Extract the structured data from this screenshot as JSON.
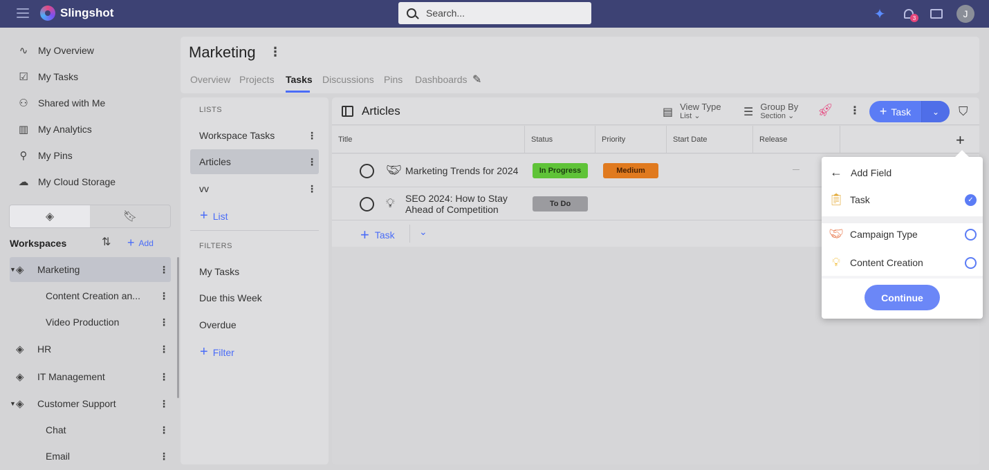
{
  "app": {
    "name": "Slingshot"
  },
  "search": {
    "placeholder": "Search..."
  },
  "notifications": {
    "count": "3"
  },
  "user": {
    "initial": "J"
  },
  "nav": [
    {
      "label": "My Overview",
      "icon": "pulse-icon"
    },
    {
      "label": "My Tasks",
      "icon": "clipboard-check-icon"
    },
    {
      "label": "Shared with Me",
      "icon": "user-check-icon"
    },
    {
      "label": "My Analytics",
      "icon": "bar-chart-icon"
    },
    {
      "label": "My Pins",
      "icon": "pin-icon"
    },
    {
      "label": "My Cloud Storage",
      "icon": "cloud-icon"
    }
  ],
  "workspaces": {
    "title": "Workspaces",
    "add_label": "Add",
    "items": [
      {
        "label": "Marketing",
        "level": 0,
        "expanded": true,
        "selected": true
      },
      {
        "label": "Content Creation an...",
        "level": 1
      },
      {
        "label": "Video Production",
        "level": 1
      },
      {
        "label": "HR",
        "level": 0
      },
      {
        "label": "IT Management",
        "level": 0
      },
      {
        "label": "Customer Support",
        "level": 0,
        "expanded": true
      },
      {
        "label": "Chat",
        "level": 1
      },
      {
        "label": "Email",
        "level": 1
      }
    ]
  },
  "header": {
    "title": "Marketing",
    "tabs": [
      "Overview",
      "Projects",
      "Tasks",
      "Discussions",
      "Pins",
      "Dashboards"
    ],
    "active_tab": "Tasks"
  },
  "lists_panel": {
    "lists_label": "LISTS",
    "lists": [
      "Workspace Tasks",
      "Articles",
      "vv"
    ],
    "selected_list": "Articles",
    "add_list_label": "List",
    "filters_label": "FILTERS",
    "filters": [
      "My Tasks",
      "Due this Week",
      "Overdue"
    ],
    "add_filter_label": "Filter"
  },
  "main": {
    "title": "Articles",
    "view_type": {
      "label": "View Type",
      "value": "List"
    },
    "group_by": {
      "label": "Group By",
      "value": "Section"
    },
    "task_button": "Task",
    "columns": [
      "Title",
      "Status",
      "Priority",
      "Start Date",
      "Release"
    ],
    "rows": [
      {
        "title": "Marketing Trends for 2024",
        "status": "In Progress",
        "priority": "Medium",
        "release": "—"
      },
      {
        "title_line1": "SEO 2024: How to Stay",
        "title_line2": "Ahead of Competition",
        "status": "To Do"
      }
    ],
    "add_task_label": "Task"
  },
  "colors": {
    "topbar": "#3d4274",
    "accent": "#5b7cf5",
    "in_progress": "#5fc338",
    "medium": "#e07a1f",
    "todo": "#9b9b9f"
  },
  "popover": {
    "title": "Add Field",
    "items": [
      {
        "label": "Task",
        "checked": true,
        "icon": "clipboard-icon"
      },
      {
        "label": "Campaign Type",
        "checked": false,
        "icon": "handshake-icon"
      },
      {
        "label": "Content Creation",
        "checked": false,
        "icon": "lightbulb-icon"
      }
    ],
    "continue_label": "Continue"
  }
}
